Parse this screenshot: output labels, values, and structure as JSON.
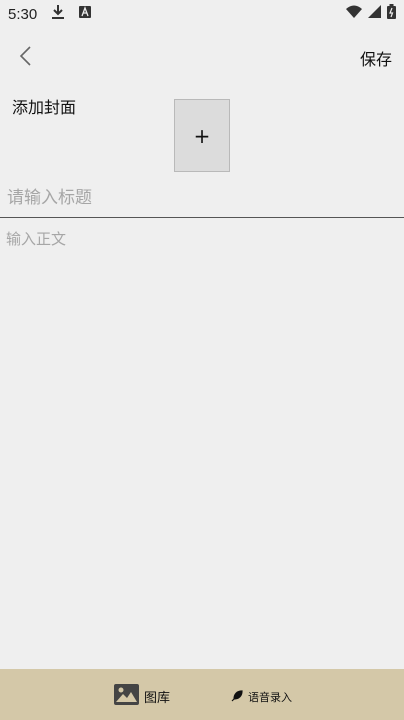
{
  "status_bar": {
    "time": "5:30",
    "icons": [
      "download-icon",
      "app-a-icon",
      "wifi-icon",
      "signal-icon",
      "battery-icon"
    ]
  },
  "toolbar": {
    "back_icon": "chevron-left-icon",
    "save_label": "保存"
  },
  "cover": {
    "label": "添加封面",
    "add_symbol": "+"
  },
  "editor": {
    "title_placeholder": "请输入标题",
    "body_placeholder": "输入正文"
  },
  "bottom_bar": {
    "gallery_label": "图库",
    "voice_label": "语音录入",
    "background": "#d4c8a8"
  }
}
